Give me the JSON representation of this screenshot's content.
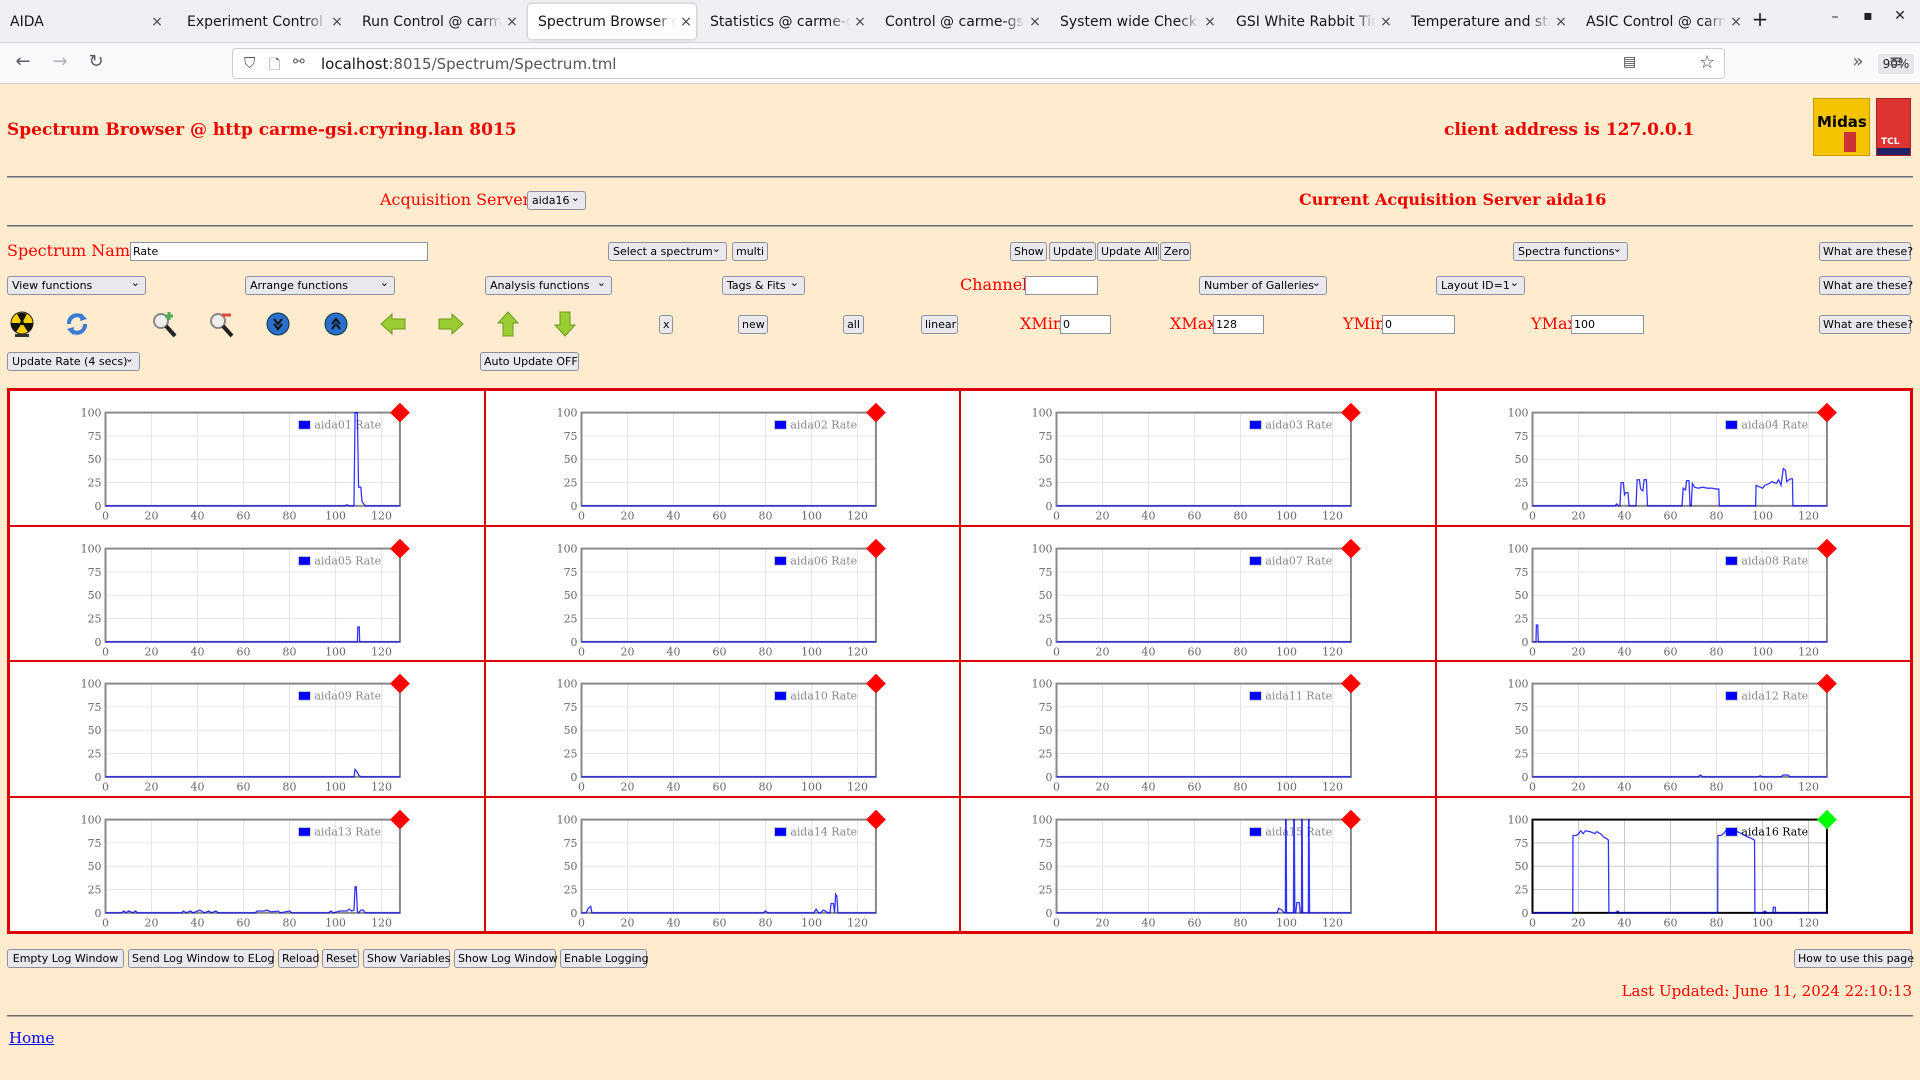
{
  "browser": {
    "tabs": [
      {
        "label": "AIDA",
        "active": false
      },
      {
        "label": "Experiment Control @ carme-gsi",
        "active": false
      },
      {
        "label": "Run Control @ carme-gsi",
        "active": false
      },
      {
        "label": "Spectrum Browser @ carme-gsi",
        "active": true
      },
      {
        "label": "Statistics @ carme-gsi",
        "active": false
      },
      {
        "label": "Control @ carme-gsi",
        "active": false
      },
      {
        "label": "System wide Checks @",
        "active": false
      },
      {
        "label": "GSI White Rabbit Timestamp",
        "active": false
      },
      {
        "label": "Temperature and status",
        "active": false
      },
      {
        "label": "ASIC Control @ carme-gsi",
        "active": false
      }
    ],
    "url_host": "localhost",
    "url_rest": ":8015/Spectrum/Spectrum.tml",
    "zoom": "90%",
    "close_glyph": "×",
    "new_tab_glyph": "+"
  },
  "header": {
    "title": "Spectrum Browser @ http carme-gsi.cryring.lan 8015",
    "client_address": "client address is 127.0.0.1",
    "logos": [
      "Midas",
      "TCL"
    ]
  },
  "acquisition": {
    "label": "Acquisition Servers",
    "selected": "aida16",
    "current": "Current Acquisition Server aida16"
  },
  "controls": {
    "spectrum_name_label": "Spectrum Name:",
    "spectrum_name_value": "Rate",
    "select_spectrum": "Select a spectrum",
    "multi": "multi",
    "show": "Show",
    "update": "Update",
    "update_all": "Update All",
    "zero": "Zero",
    "spectra_functions": "Spectra functions",
    "what_are_these": "What are these?",
    "view_functions": "View functions",
    "arrange_functions": "Arrange functions",
    "analysis_functions": "Analysis functions",
    "tags_fits": "Tags & Fits",
    "channel_label": "Channel:",
    "channel_value": "",
    "number_of_galleries": "Number of Galleries",
    "layout_id": "Layout ID=1",
    "x_btn": "x",
    "new_btn": "new",
    "all_btn": "all",
    "linear_btn": "linear",
    "xmin_label": "XMin",
    "xmin_value": "0",
    "xmax_label": "XMax",
    "xmax_value": "128",
    "ymin_label": "YMin",
    "ymin_value": "0",
    "ymax_label": "YMax",
    "ymax_value": "100",
    "update_rate": "Update Rate (4 secs)",
    "auto_update": "Auto Update OFF",
    "icons": [
      "radiation-icon",
      "refresh-icon",
      "zoom-in-icon",
      "zoom-out-icon",
      "scroll-down-icon",
      "scroll-up-icon",
      "arrow-left-icon",
      "arrow-right-icon",
      "arrow-up-icon",
      "arrow-down-icon"
    ]
  },
  "footer": {
    "buttons": [
      "Empty Log Window",
      "Send Log Window to ELog",
      "Reload",
      "Reset",
      "Show Variables",
      "Show Log Window",
      "Enable Logging"
    ],
    "how_to": "How to use this page",
    "last_updated": "Last Updated: June 11, 2024 22:10:13",
    "home": "Home"
  },
  "colors": {
    "accent_red": "#ff0000",
    "line_blue": "#0000ff",
    "status_red": "#ff0000",
    "status_green": "#00ff00",
    "background": "#ffebcd"
  },
  "chart_data": {
    "type": "line",
    "xlim": [
      0,
      128
    ],
    "ylim": [
      0,
      100
    ],
    "xticks": [
      0,
      20,
      40,
      60,
      80,
      100,
      120
    ],
    "yticks": [
      0,
      25,
      50,
      75,
      100
    ],
    "grid": true,
    "legend_placement": "top-right",
    "panels": [
      {
        "name": "aida01 Rate",
        "status": "red",
        "points": [
          [
            0,
            0
          ],
          [
            104,
            0
          ],
          [
            105,
            1
          ],
          [
            106,
            0
          ],
          [
            108,
            0
          ],
          [
            108.5,
            100
          ],
          [
            109.5,
            100
          ],
          [
            110,
            20
          ],
          [
            111,
            20
          ],
          [
            111.5,
            5
          ],
          [
            112,
            3
          ],
          [
            113,
            0
          ],
          [
            128,
            0
          ]
        ]
      },
      {
        "name": "aida02 Rate",
        "status": "red",
        "points": [
          [
            0,
            0
          ],
          [
            128,
            0
          ]
        ]
      },
      {
        "name": "aida03 Rate",
        "status": "red",
        "points": [
          [
            0,
            0
          ],
          [
            128,
            0
          ]
        ]
      },
      {
        "name": "aida04 Rate",
        "status": "red",
        "points": [
          [
            0,
            0
          ],
          [
            36,
            0
          ],
          [
            36.5,
            2
          ],
          [
            37.5,
            0
          ],
          [
            38,
            0
          ],
          [
            38.5,
            25
          ],
          [
            39.5,
            25
          ],
          [
            40,
            12
          ],
          [
            40.5,
            14
          ],
          [
            41.5,
            14
          ],
          [
            42,
            0
          ],
          [
            45,
            0
          ],
          [
            45.5,
            28
          ],
          [
            46.5,
            28
          ],
          [
            47,
            18
          ],
          [
            48,
            16
          ],
          [
            48.5,
            28
          ],
          [
            49.5,
            28
          ],
          [
            50,
            0
          ],
          [
            65,
            0
          ],
          [
            65.5,
            19
          ],
          [
            66.5,
            17
          ],
          [
            67,
            27
          ],
          [
            68,
            27
          ],
          [
            68.5,
            0
          ],
          [
            69,
            0
          ],
          [
            69.5,
            24
          ],
          [
            70.5,
            20
          ],
          [
            72,
            19
          ],
          [
            74,
            20
          ],
          [
            76,
            19
          ],
          [
            78,
            19
          ],
          [
            80,
            18
          ],
          [
            81,
            18
          ],
          [
            81.2,
            0
          ],
          [
            97,
            0
          ],
          [
            97.2,
            22
          ],
          [
            99,
            20
          ],
          [
            100,
            19
          ],
          [
            101,
            22
          ],
          [
            103,
            24
          ],
          [
            104,
            26
          ],
          [
            106,
            24
          ],
          [
            107,
            28
          ],
          [
            108,
            22
          ],
          [
            109,
            40
          ],
          [
            110,
            38
          ],
          [
            110.5,
            26
          ],
          [
            112,
            29
          ],
          [
            113,
            29
          ],
          [
            113.2,
            0
          ],
          [
            128,
            0
          ]
        ]
      },
      {
        "name": "aida05 Rate",
        "status": "red",
        "points": [
          [
            0,
            0
          ],
          [
            109.5,
            0
          ],
          [
            109.7,
            16
          ],
          [
            110.3,
            16
          ],
          [
            110.5,
            0
          ],
          [
            128,
            0
          ]
        ]
      },
      {
        "name": "aida06 Rate",
        "status": "red",
        "points": [
          [
            0,
            0
          ],
          [
            128,
            0
          ]
        ]
      },
      {
        "name": "aida07 Rate",
        "status": "red",
        "points": [
          [
            0,
            0
          ],
          [
            128,
            0
          ]
        ]
      },
      {
        "name": "aida08 Rate",
        "status": "red",
        "points": [
          [
            0,
            0
          ],
          [
            1.5,
            0
          ],
          [
            1.7,
            18
          ],
          [
            2.3,
            18
          ],
          [
            2.5,
            0
          ],
          [
            128,
            0
          ]
        ]
      },
      {
        "name": "aida09 Rate",
        "status": "red",
        "points": [
          [
            0,
            0
          ],
          [
            108,
            0
          ],
          [
            108.5,
            8
          ],
          [
            109.5,
            5
          ],
          [
            110,
            2
          ],
          [
            111,
            0
          ],
          [
            128,
            0
          ]
        ]
      },
      {
        "name": "aida10 Rate",
        "status": "red",
        "points": [
          [
            0,
            0
          ],
          [
            128,
            0
          ]
        ]
      },
      {
        "name": "aida11 Rate",
        "status": "red",
        "points": [
          [
            0,
            0
          ],
          [
            128,
            0
          ]
        ]
      },
      {
        "name": "aida12 Rate",
        "status": "red",
        "points": [
          [
            0,
            0
          ],
          [
            72,
            0
          ],
          [
            73,
            2
          ],
          [
            74,
            0
          ],
          [
            98,
            0
          ],
          [
            99,
            1
          ],
          [
            100,
            0
          ],
          [
            108,
            0
          ],
          [
            109,
            2
          ],
          [
            111,
            2
          ],
          [
            112,
            0
          ],
          [
            128,
            0
          ]
        ]
      },
      {
        "name": "aida13 Rate",
        "status": "red",
        "points": [
          [
            0,
            0
          ],
          [
            7,
            0
          ],
          [
            8,
            2
          ],
          [
            9,
            0
          ],
          [
            10,
            2
          ],
          [
            12,
            0
          ],
          [
            13,
            2
          ],
          [
            14,
            0
          ],
          [
            33,
            0
          ],
          [
            34,
            2
          ],
          [
            35,
            0
          ],
          [
            37,
            2
          ],
          [
            38,
            0
          ],
          [
            41,
            3
          ],
          [
            43,
            0
          ],
          [
            45,
            2
          ],
          [
            46,
            0
          ],
          [
            48,
            2
          ],
          [
            49,
            0
          ],
          [
            65,
            0
          ],
          [
            66,
            2
          ],
          [
            69,
            2
          ],
          [
            70,
            3
          ],
          [
            72,
            1
          ],
          [
            75,
            2
          ],
          [
            76,
            0
          ],
          [
            80,
            2
          ],
          [
            81,
            0
          ],
          [
            97,
            0
          ],
          [
            98,
            2
          ],
          [
            99,
            0
          ],
          [
            102,
            2
          ],
          [
            105,
            2
          ],
          [
            106,
            4
          ],
          [
            107,
            2
          ],
          [
            108,
            3
          ],
          [
            108.5,
            28
          ],
          [
            109,
            28
          ],
          [
            109.5,
            2
          ],
          [
            110,
            0
          ],
          [
            111,
            3
          ],
          [
            112,
            3
          ],
          [
            113,
            0
          ],
          [
            128,
            0
          ]
        ]
      },
      {
        "name": "aida14 Rate",
        "status": "red",
        "points": [
          [
            0,
            0
          ],
          [
            2,
            0
          ],
          [
            3,
            5
          ],
          [
            4,
            7
          ],
          [
            4.5,
            0
          ],
          [
            79,
            0
          ],
          [
            80,
            2
          ],
          [
            81,
            0
          ],
          [
            101,
            0
          ],
          [
            102,
            4
          ],
          [
            103,
            0
          ],
          [
            104,
            0
          ],
          [
            105,
            3
          ],
          [
            106,
            2
          ],
          [
            107,
            0
          ],
          [
            108,
            0
          ],
          [
            108.5,
            10
          ],
          [
            109.5,
            10
          ],
          [
            110,
            0
          ],
          [
            110.5,
            20
          ],
          [
            111,
            18
          ],
          [
            111.5,
            0
          ],
          [
            128,
            0
          ]
        ]
      },
      {
        "name": "aida15 Rate",
        "status": "red",
        "points": [
          [
            0,
            0
          ],
          [
            96,
            0
          ],
          [
            96.5,
            5
          ],
          [
            98,
            3
          ],
          [
            99,
            0
          ],
          [
            99.5,
            0
          ],
          [
            99.6,
            100
          ],
          [
            99.8,
            100
          ],
          [
            100,
            0
          ],
          [
            103,
            0
          ],
          [
            103.2,
            100
          ],
          [
            103.4,
            100
          ],
          [
            103.6,
            0
          ],
          [
            104,
            0
          ],
          [
            104.5,
            11
          ],
          [
            105.5,
            11
          ],
          [
            106,
            0
          ],
          [
            106.5,
            0
          ],
          [
            106.6,
            100
          ],
          [
            106.8,
            100
          ],
          [
            107,
            0
          ],
          [
            109.5,
            0
          ],
          [
            109.6,
            100
          ],
          [
            109.8,
            100
          ],
          [
            110,
            0
          ],
          [
            128,
            0
          ]
        ]
      },
      {
        "name": "aida16 Rate",
        "status": "green",
        "active": true,
        "points": [
          [
            0,
            0
          ],
          [
            17.5,
            0
          ],
          [
            17.6,
            83
          ],
          [
            19,
            83
          ],
          [
            20,
            85
          ],
          [
            21,
            88
          ],
          [
            22,
            85
          ],
          [
            23,
            88
          ],
          [
            25,
            87
          ],
          [
            27,
            85
          ],
          [
            28,
            87
          ],
          [
            30,
            84
          ],
          [
            31,
            81
          ],
          [
            32,
            80
          ],
          [
            33,
            78
          ],
          [
            33.2,
            0
          ],
          [
            36,
            0
          ],
          [
            37,
            2
          ],
          [
            38,
            0
          ],
          [
            80.5,
            0
          ],
          [
            80.6,
            83
          ],
          [
            82,
            83
          ],
          [
            83,
            85
          ],
          [
            84,
            88
          ],
          [
            85,
            86
          ],
          [
            87,
            88
          ],
          [
            89,
            87
          ],
          [
            91,
            85
          ],
          [
            93,
            82
          ],
          [
            95,
            80
          ],
          [
            96.5,
            78
          ],
          [
            96.7,
            0
          ],
          [
            100,
            0
          ],
          [
            101,
            2
          ],
          [
            102,
            0
          ],
          [
            104.5,
            0
          ],
          [
            104.7,
            6
          ],
          [
            105.5,
            6
          ],
          [
            105.7,
            0
          ],
          [
            128,
            0
          ]
        ]
      }
    ]
  }
}
